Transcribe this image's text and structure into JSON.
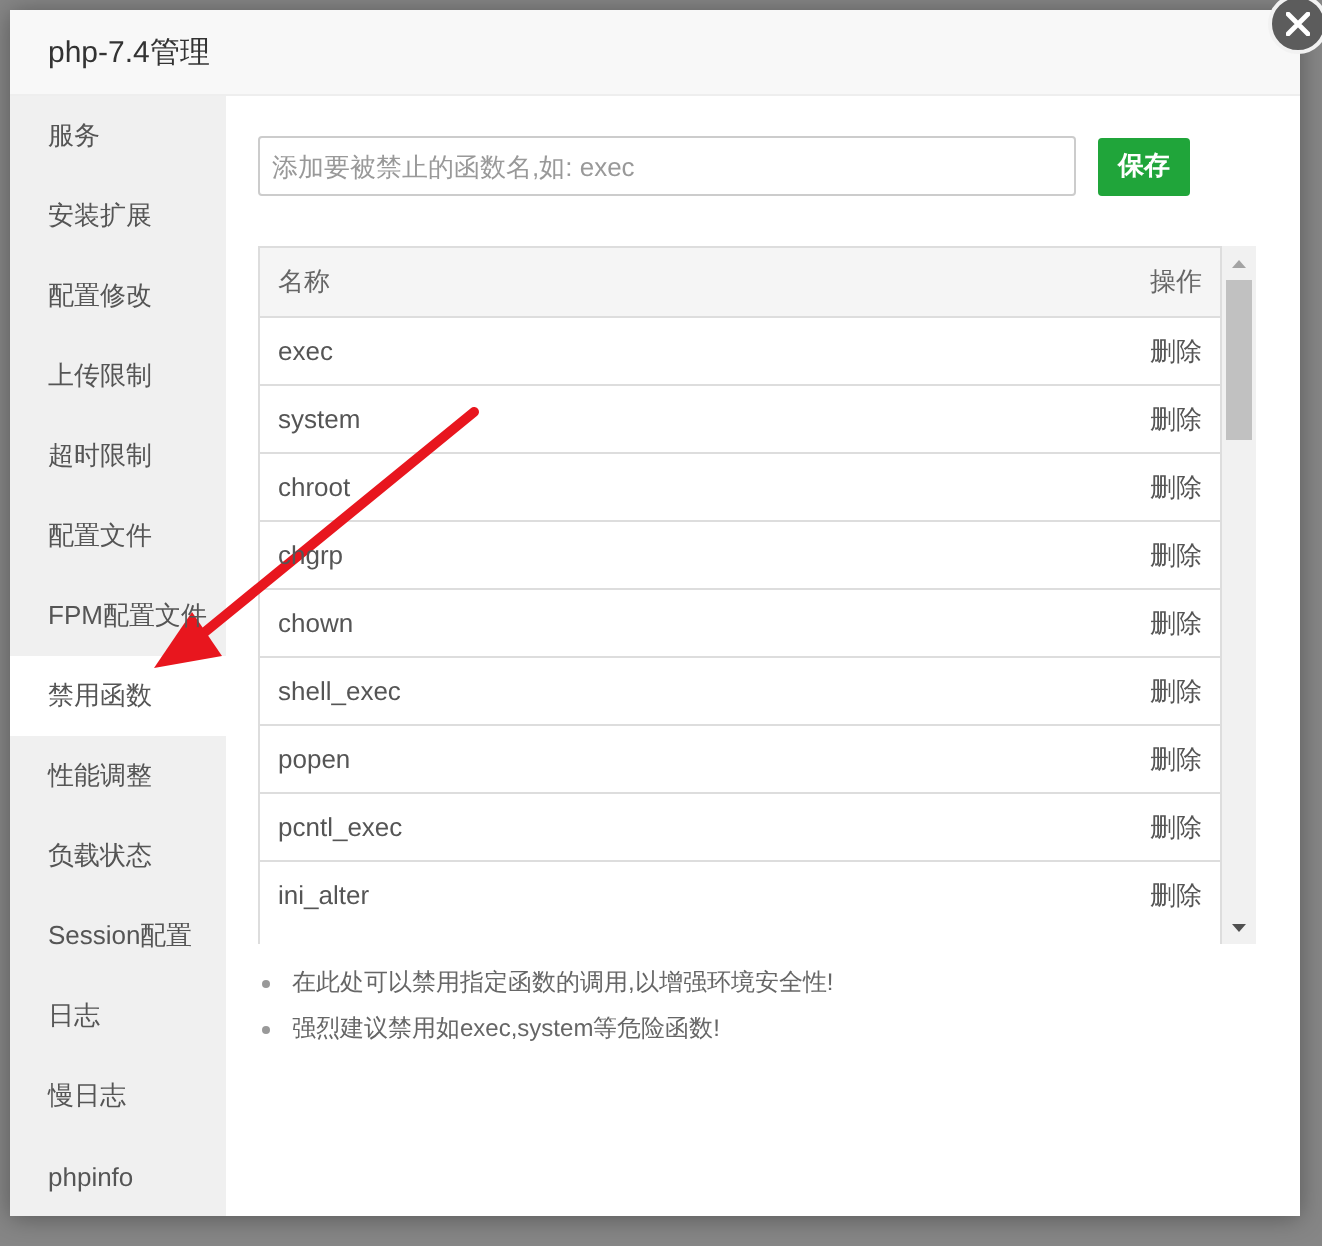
{
  "dialog": {
    "title": "php-7.4管理"
  },
  "sidebar": {
    "items": [
      {
        "label": "服务",
        "selected": false
      },
      {
        "label": "安装扩展",
        "selected": false
      },
      {
        "label": "配置修改",
        "selected": false
      },
      {
        "label": "上传限制",
        "selected": false
      },
      {
        "label": "超时限制",
        "selected": false
      },
      {
        "label": "配置文件",
        "selected": false
      },
      {
        "label": "FPM配置文件",
        "selected": false
      },
      {
        "label": "禁用函数",
        "selected": true
      },
      {
        "label": "性能调整",
        "selected": false
      },
      {
        "label": "负载状态",
        "selected": false
      },
      {
        "label": "Session配置",
        "selected": false
      },
      {
        "label": "日志",
        "selected": false
      },
      {
        "label": "慢日志",
        "selected": false
      },
      {
        "label": "phpinfo",
        "selected": false
      }
    ]
  },
  "add_form": {
    "placeholder": "添加要被禁止的函数名,如: exec",
    "button": "保存"
  },
  "table": {
    "columns": [
      "名称",
      "操作"
    ],
    "rows": [
      {
        "name": "exec",
        "action": "删除"
      },
      {
        "name": "system",
        "action": "删除"
      },
      {
        "name": "chroot",
        "action": "删除"
      },
      {
        "name": "chgrp",
        "action": "删除"
      },
      {
        "name": "chown",
        "action": "删除"
      },
      {
        "name": "shell_exec",
        "action": "删除"
      },
      {
        "name": "popen",
        "action": "删除"
      },
      {
        "name": "pcntl_exec",
        "action": "删除"
      },
      {
        "name": "ini_alter",
        "action": "删除"
      }
    ]
  },
  "notes": [
    "在此处可以禁用指定函数的调用,以增强环境安全性!",
    "强烈建议禁用如exec,system等危险函数!"
  ]
}
